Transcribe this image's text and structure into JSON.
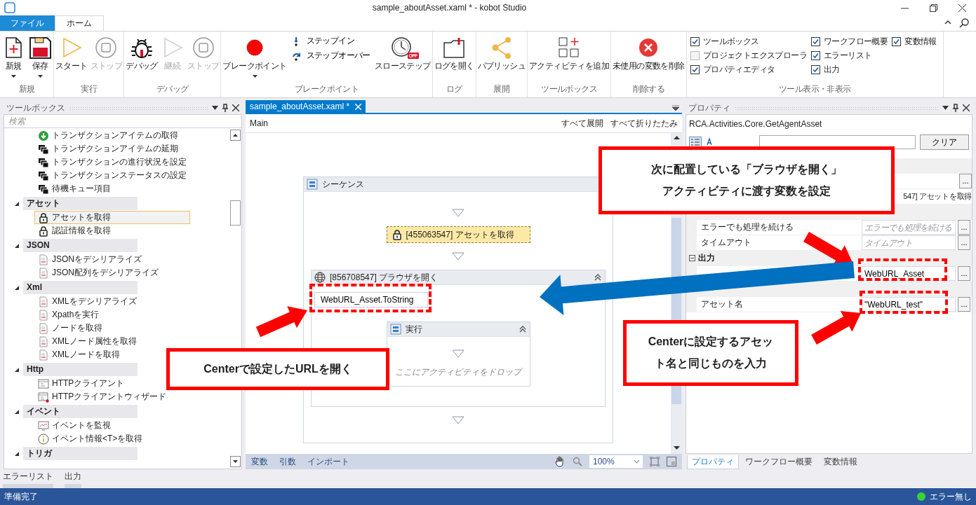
{
  "window": {
    "title": "sample_aboutAsset.xaml * - kobot Studio"
  },
  "ribbon": {
    "tabs": [
      {
        "label": "ファイル",
        "kind": "file",
        "selected": false
      },
      {
        "label": "ホーム",
        "kind": "page",
        "selected": true
      }
    ],
    "groups": [
      {
        "label": "新規",
        "items": [
          {
            "kind": "new",
            "label": "新規",
            "disabled": false,
            "dropdown": true
          },
          {
            "kind": "save",
            "label": "保存",
            "disabled": false,
            "dropdown": true
          }
        ]
      },
      {
        "label": "実行",
        "items": [
          {
            "kind": "play",
            "label": "スタート",
            "disabled": false,
            "dropdown": false
          },
          {
            "kind": "stop",
            "label": "ストップ",
            "disabled": true,
            "dropdown": false
          }
        ]
      },
      {
        "label": "デバッグ",
        "items": [
          {
            "kind": "bug",
            "label": "デバッグ",
            "disabled": false,
            "dropdown": false
          },
          {
            "kind": "play",
            "label": "継続",
            "disabled": true,
            "dropdown": false
          },
          {
            "kind": "stop",
            "label": "ストップ",
            "disabled": true,
            "dropdown": false
          }
        ]
      },
      {
        "label": "ブレークポイント",
        "items": [
          {
            "kind": "breakpoint",
            "label": "ブレークポイント",
            "disabled": false,
            "dropdown": true
          },
          {
            "kind": "steps",
            "entries": [
              {
                "kind": "step_in",
                "label": "ステップイン"
              },
              {
                "kind": "step_over",
                "label": "ステップオーバー"
              }
            ]
          },
          {
            "kind": "slow_step",
            "label": "スローステップ",
            "badge": "OFF",
            "disabled": false,
            "dropdown": false
          }
        ]
      },
      {
        "label": "ログ",
        "items": [
          {
            "kind": "log",
            "label": "ログを開く",
            "disabled": false,
            "dropdown": false
          }
        ]
      },
      {
        "label": "展開",
        "items": [
          {
            "kind": "share",
            "label": "パブリッシュ",
            "disabled": false,
            "dropdown": false
          }
        ]
      },
      {
        "label": "ツールボックス",
        "items": [
          {
            "kind": "add_activity",
            "label": "アクティビティを追加",
            "disabled": false,
            "dropdown": false
          }
        ]
      },
      {
        "label": "削除する",
        "items": [
          {
            "kind": "delete",
            "label": "未使用の変数を削除",
            "disabled": false,
            "dropdown": false
          }
        ]
      },
      {
        "label": "ツール表示・非表示",
        "items": [
          {
            "kind": "checks",
            "columns": [
              [
                {
                  "label": "ツールボックス",
                  "checked": true
                },
                {
                  "label": "プロジェクトエクスプローラ",
                  "checked": false
                },
                {
                  "label": "プロパティエディタ",
                  "checked": true
                }
              ],
              [
                {
                  "label": "ワークフロー概要",
                  "checked": true
                },
                {
                  "label": "エラーリスト",
                  "checked": true
                },
                {
                  "label": "出力",
                  "checked": true
                }
              ],
              [
                {
                  "label": "変数情報",
                  "checked": true
                }
              ]
            ]
          }
        ]
      }
    ]
  },
  "toolbox": {
    "title": "ツールボックス",
    "search": {
      "placeholder": "検索"
    },
    "tree": [
      {
        "children": [
          {
            "kind": "download",
            "label": "トランザクションアイテムの取得",
            "selected": false
          },
          {
            "kind": "stack",
            "label": "トランザクションアイテムの延期",
            "selected": false
          },
          {
            "kind": "stack",
            "label": "トランザクションの進行状況を設定",
            "selected": false
          },
          {
            "kind": "stack",
            "label": "トランザクションステータスの設定",
            "selected": false
          },
          {
            "kind": "stack",
            "label": "待機キュー項目",
            "selected": false
          }
        ]
      },
      {
        "label": "アセット",
        "expanded": true,
        "children": [
          {
            "kind": "lock",
            "label": "アセットを取得",
            "selected": true
          },
          {
            "kind": "lock",
            "label": "認証情報を取得",
            "selected": false
          }
        ]
      },
      {
        "label": "JSON",
        "expanded": true,
        "children": [
          {
            "kind": "doc",
            "label": "JSONをデシリアライズ",
            "selected": false
          },
          {
            "kind": "doc",
            "label": "JSON配列をデシリアライズ",
            "selected": false
          }
        ]
      },
      {
        "label": "Xml",
        "expanded": true,
        "children": [
          {
            "kind": "doc",
            "label": "XMLをデシリアライズ",
            "selected": false
          },
          {
            "kind": "doc",
            "label": "Xpathを実行",
            "selected": false
          },
          {
            "kind": "doc",
            "label": "ノードを取得",
            "selected": false
          },
          {
            "kind": "doc",
            "label": "XMLノード属性を取得",
            "selected": false
          },
          {
            "kind": "doc",
            "label": "XMLノードを取得",
            "selected": false
          }
        ]
      },
      {
        "label": "Http",
        "expanded": true,
        "children": [
          {
            "kind": "http",
            "label": "HTTPクライアント",
            "selected": false
          },
          {
            "kind": "wizard",
            "label": "HTTPクライアントウィザード",
            "selected": false
          }
        ]
      },
      {
        "label": "イベント",
        "expanded": true,
        "children": [
          {
            "kind": "monitor",
            "label": "イベントを監視",
            "selected": false
          },
          {
            "kind": "info",
            "label": "イベント情報<T>を取得",
            "selected": false
          }
        ]
      },
      {
        "label": "トリガ",
        "expanded": true
      }
    ]
  },
  "bottom_tabs": [
    "エラーリスト",
    "出力"
  ],
  "designer": {
    "tab": "sample_aboutAsset.xaml *",
    "breadcrumb": "Main",
    "actions": [
      "すべて展開",
      "すべて折りたたみ"
    ],
    "sequence": {
      "title": "シーケンス",
      "activities": [
        {
          "kind": "asset",
          "title": "[455063547] アセットを取得",
          "selected": true
        },
        {
          "kind": "browser",
          "title": "[856708547] ブラウザを開く",
          "selected": false,
          "url": "WebURL_Asset.ToString",
          "body": {
            "title": "実行",
            "placeholder": "ここにアクティビティをドロップ"
          }
        }
      ]
    },
    "bottom_tabs": [
      "変数",
      "引数",
      "インポート"
    ],
    "zoom": "100%"
  },
  "properties": {
    "title": "プロパティ",
    "type": "RCA.Activities.Core.GetAgentAsset",
    "clear": "クリア",
    "rows": [
      {
        "kind": "category"
      },
      {
        "kind": "field",
        "button": "..."
      },
      {
        "kind": "readonly",
        "value": "547] アセットを取得"
      },
      {
        "kind": "category"
      },
      {
        "kind": "field",
        "label": "エラーでも処理を続ける",
        "placeholder": "エラーでも処理を続ける",
        "button": "..."
      },
      {
        "kind": "field",
        "label": "タイムアウト",
        "placeholder": "タイムアウト",
        "button": "..."
      },
      {
        "kind": "category",
        "label": "出力",
        "expanded": true
      },
      {
        "kind": "field",
        "value": "WebURL_Asset",
        "button": "..."
      },
      {
        "kind": "category"
      },
      {
        "kind": "field",
        "label": "アセット名",
        "value": "\"WebURL_test\"",
        "button": "..."
      }
    ],
    "bottom_tabs": [
      {
        "label": "プロパティ",
        "selected": true
      },
      {
        "label": "ワークフロー概要",
        "selected": false
      },
      {
        "label": "変数情報",
        "selected": false
      }
    ]
  },
  "status_bar": {
    "text": "準備完了",
    "errors": "エラー無し"
  },
  "annotations": [
    {
      "kind": "callout",
      "color": "#ff0000",
      "lines": [
        "次に配置している「ブラウザを開く」",
        "アクティビティに渡す変数を設定"
      ]
    },
    {
      "kind": "arrow",
      "color": "#ff0000"
    },
    {
      "kind": "highlight",
      "color": "#ff0000"
    },
    {
      "kind": "arrow",
      "color": "#0070c0"
    },
    {
      "kind": "highlight",
      "color": "#ff0000"
    },
    {
      "kind": "arrow",
      "color": "#ff0000"
    },
    {
      "kind": "callout",
      "color": "#ff0000",
      "lines": [
        "Centerに設定するアセッ",
        "ト名と同じものを入力"
      ]
    },
    {
      "kind": "highlight",
      "color": "#ff0000"
    },
    {
      "kind": "arrow",
      "color": "#ff0000"
    },
    {
      "kind": "callout",
      "color": "#ff0000",
      "lines": [
        "Centerで設定したURLを開く"
      ]
    }
  ]
}
